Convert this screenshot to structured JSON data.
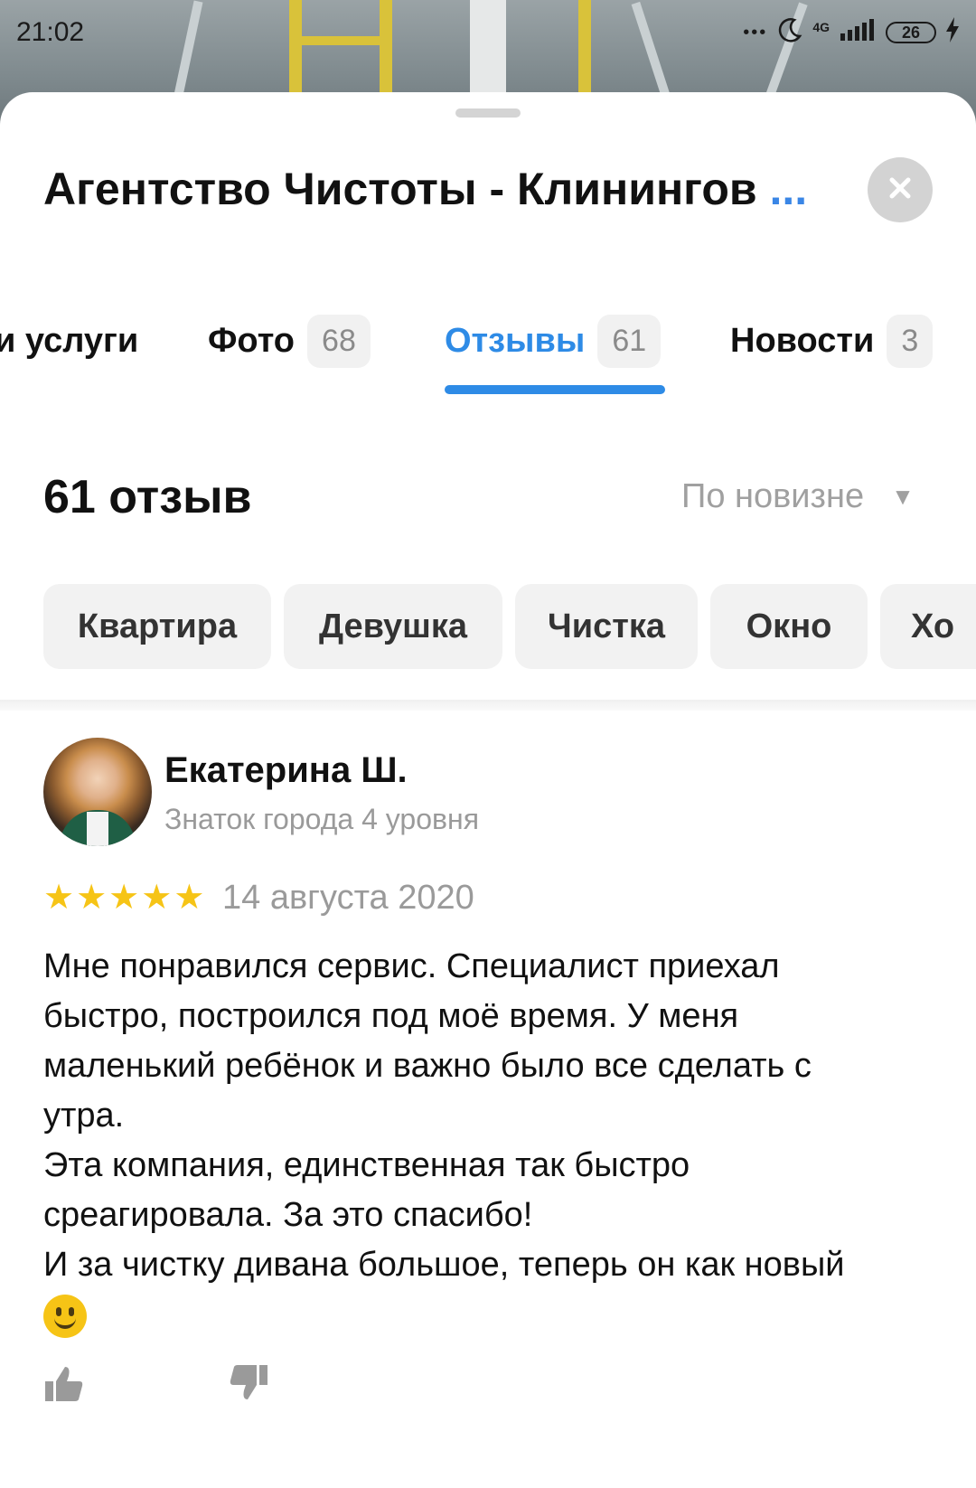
{
  "status_bar": {
    "time": "21:02",
    "dots": "•••",
    "network": "4G",
    "battery": "26"
  },
  "header": {
    "title": "Агентство Чистоты - Клинингов",
    "title_ellipsis": "..."
  },
  "tabs": [
    {
      "label": "и услуги",
      "count": ""
    },
    {
      "label": "Фото",
      "count": "68"
    },
    {
      "label": "Отзывы",
      "count": "61",
      "active": true
    },
    {
      "label": "Новости",
      "count": "3"
    }
  ],
  "reviews_header": {
    "count_heading": "61 отзыв",
    "sort_label": "По новизне",
    "sort_arrow": "▼"
  },
  "chips": [
    "Квартира",
    "Девушка",
    "Чистка",
    "Окно",
    "Хо"
  ],
  "review": {
    "author": "Екатерина Ш.",
    "level": "Знаток города 4 уровня",
    "rating": 5,
    "star_glyph": "★",
    "date": "14 августа 2020",
    "text": "Мне понравился сервис. Специалист приехал\nбыстро, построился под моё время. У меня\nмаленький ребёнок и важно было все сделать с\nутра.\nЭта компания, единственная так быстро\nсреагировала. За это спасибо!\nИ за чистку дивана большое, теперь он как новый"
  },
  "colors": {
    "accent": "#2e8be6",
    "star": "#f6c416",
    "muted": "#9a9a9a",
    "chip_bg": "#f2f2f2"
  },
  "icons": {
    "close": "close-icon",
    "like": "thumbs-up-icon",
    "dislike": "thumbs-down-icon",
    "emoji": "smile-emoji-icon"
  }
}
